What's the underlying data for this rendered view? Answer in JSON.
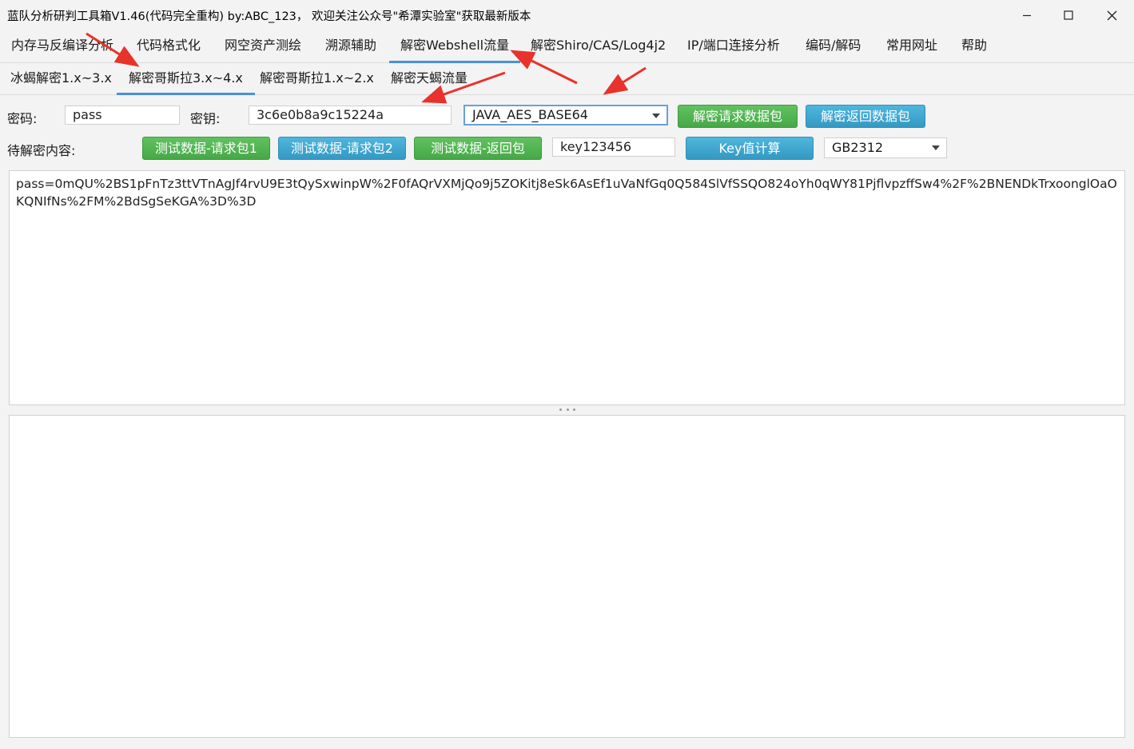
{
  "window": {
    "title": "蓝队分析研判工具箱V1.46(代码完全重构) by:ABC_123， 欢迎关注公众号\"希潭实验室\"获取最新版本"
  },
  "menu": {
    "items": [
      {
        "label": "内存马反编译分析"
      },
      {
        "label": "代码格式化"
      },
      {
        "label": "网空资产测绘"
      },
      {
        "label": "溯源辅助"
      },
      {
        "label": "解密Webshell流量"
      },
      {
        "label": "解密Shiro/CAS/Log4j2"
      },
      {
        "label": "IP/端口连接分析"
      },
      {
        "label": "编码/解码"
      },
      {
        "label": "常用网址"
      },
      {
        "label": "帮助"
      }
    ],
    "active_index": 4
  },
  "subtabs": {
    "items": [
      {
        "label": "冰蝎解密1.x~3.x"
      },
      {
        "label": "解密哥斯拉3.x~4.x"
      },
      {
        "label": "解密哥斯拉1.x~2.x"
      },
      {
        "label": "解密天蝎流量"
      }
    ],
    "active_index": 1
  },
  "form": {
    "password_label": "密码:",
    "password_value": "pass",
    "key_label": "密钥:",
    "key_value": "3c6e0b8a9c15224a",
    "mode_selected": "JAVA_AES_BASE64",
    "decrypt_request_btn": "解密请求数据包",
    "decrypt_response_btn": "解密返回数据包",
    "content_label": "待解密内容:",
    "test_req1_btn": "测试数据-请求包1",
    "test_req2_btn": "测试数据-请求包2",
    "test_resp_btn": "测试数据-返回包",
    "key_input_value": "key123456",
    "key_calc_btn": "Key值计算",
    "charset_selected": "GB2312"
  },
  "editor": {
    "input_text": "pass=0mQU%2BS1pFnTz3ttVTnAgJf4rvU9E3tQySxwinpW%2F0fAQrVXMjQo9j5ZOKitj8eSk6AsEf1uVaNfGq0Q584SlVfSSQO824oYh0qWY81PjflvpzffSw4%2F%2BNENDkTrxoonglOaOKQNIfNs%2FM%2BdSgSeKGA%3D%3D",
    "output_text": ""
  },
  "colors": {
    "accent_underline": "#4a90d9",
    "green_button": "#4cb04c",
    "blue_button": "#3aa3cf",
    "annotation_arrow": "#e8322b"
  }
}
